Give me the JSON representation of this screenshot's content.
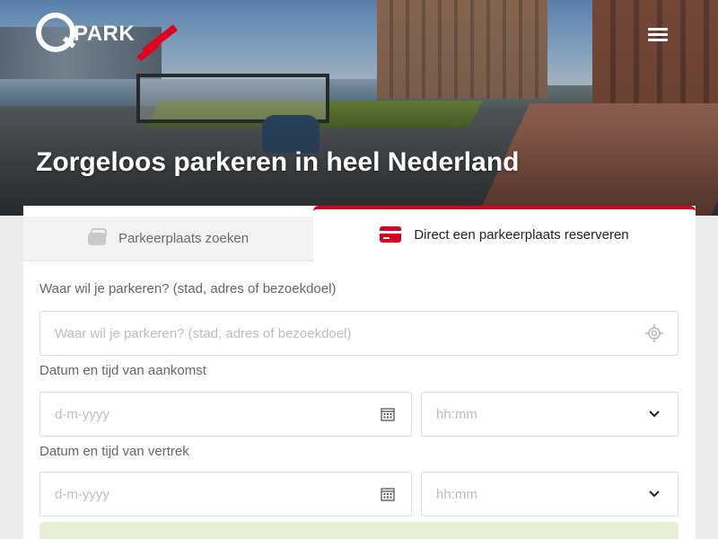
{
  "brand": {
    "logo_text": "PARK",
    "accent_color": "#e3001b"
  },
  "hero": {
    "title": "Zorgeloos parkeren in heel Nederland"
  },
  "tabs": [
    {
      "label": "Parkeerplaats zoeken",
      "icon": "car-icon",
      "active": false
    },
    {
      "label": "Direct een parkeerplaats reserveren",
      "icon": "credit-card-icon",
      "active": true
    }
  ],
  "form": {
    "location": {
      "label": "Waar wil je parkeren? (stad, adres of bezoekdoel)",
      "placeholder": "Waar wil je parkeren? (stad, adres of bezoekdoel)",
      "icon": "locate-icon"
    },
    "arrival": {
      "label": "Datum en tijd van aankomst",
      "date_placeholder": "d-m-yyyy",
      "time_placeholder": "hh:mm"
    },
    "departure": {
      "label": "Datum en tijd van vertrek",
      "date_placeholder": "d-m-yyyy",
      "time_placeholder": "hh:mm"
    }
  }
}
